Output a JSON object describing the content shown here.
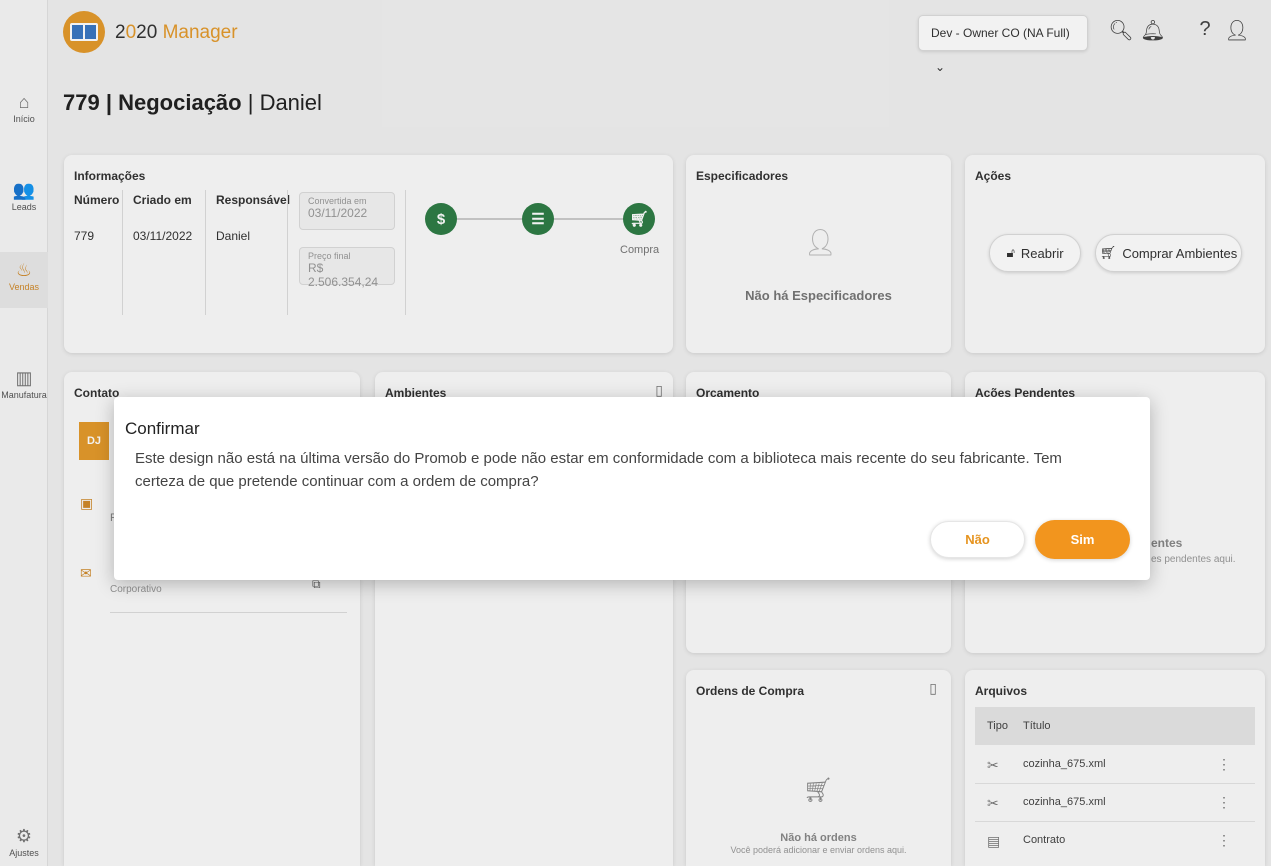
{
  "app": {
    "logo_prefix": "2",
    "logo_accent": "0",
    "logo_mid": "20",
    "logo_suffix": " Manager"
  },
  "org_selector": "Dev - Owner CO (NA Full)",
  "sidebar": [
    {
      "label": "Início",
      "icon": "home-icon"
    },
    {
      "label": "Leads",
      "icon": "people-icon"
    },
    {
      "label": "Vendas",
      "icon": "handshake-icon"
    },
    {
      "label": "Manufatura",
      "icon": "factory-icon"
    },
    {
      "label": "Ajustes",
      "icon": "gear-icon"
    }
  ],
  "page": {
    "number": "779",
    "sep": " | ",
    "stage": "Negociação",
    "sep2": " | ",
    "client": "Daniel"
  },
  "info": {
    "title": "Informações",
    "col_numero": "Número",
    "numero": "779",
    "col_criado": "Criado em",
    "criado": "03/11/2022",
    "col_resp": "Responsável",
    "resp": "Daniel",
    "convertida_label": "Convertida em",
    "convertida": "03/11/2022",
    "preco_label": "Preço final",
    "preco": "R$ 2.506.354,24",
    "step3_label": "Compra"
  },
  "especificadores": {
    "title": "Especificadores",
    "empty": "Não há Especificadores"
  },
  "acoes": {
    "title": "Ações",
    "reabrir": "Reabrir",
    "comprar": "Comprar Ambientes"
  },
  "contato": {
    "title": "Contato",
    "initials": "DJ",
    "row1_sub": "R",
    "row2_sub": "Corporativo"
  },
  "ambientes": {
    "title": "Ambientes"
  },
  "orcamento": {
    "title": "Orçamento"
  },
  "pendentes": {
    "title": "Ações Pendentes",
    "empty_title": "entes",
    "empty_sub": "es pendentes aqui."
  },
  "ordens": {
    "title": "Ordens de Compra",
    "empty_title": "Não há ordens",
    "empty_sub": "Você poderá adicionar e enviar ordens aqui."
  },
  "arquivos": {
    "title": "Arquivos",
    "col_tipo": "Tipo",
    "col_titulo": "Título",
    "rows": [
      {
        "name": "cozinha_675.xml"
      },
      {
        "name": "cozinha_675.xml"
      },
      {
        "name": "Contrato"
      }
    ]
  },
  "dialog": {
    "title": "Confirmar",
    "message": "Este design não está na última versão do Promob e pode não estar em conformidade com a biblioteca mais recente do seu fabricante. Tem certeza de que pretende continuar com a ordem de compra?",
    "no": "Não",
    "yes": "Sim"
  }
}
